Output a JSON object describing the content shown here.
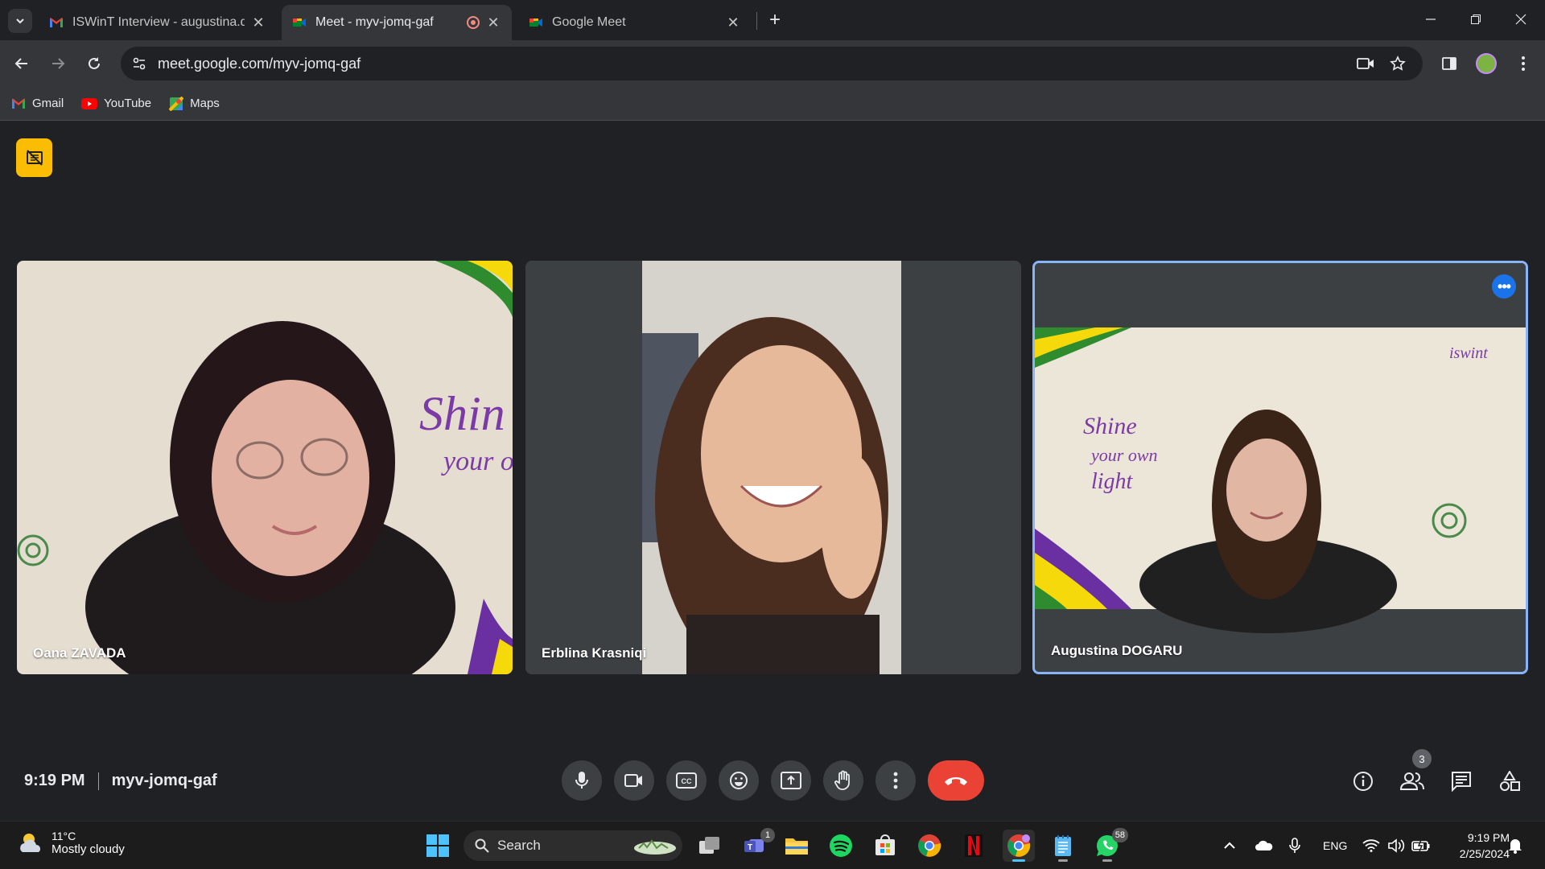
{
  "tabs": [
    {
      "title": "ISWinT Interview - augustina.do",
      "favicon": "gmail-icon"
    },
    {
      "title": "Meet - myv-jomq-gaf",
      "favicon": "meet-icon",
      "recording": true
    },
    {
      "title": "Google Meet",
      "favicon": "meet-icon"
    }
  ],
  "address": {
    "url": "meet.google.com/myv-jomq-gaf"
  },
  "bookmarks": [
    {
      "label": "Gmail",
      "icon": "gmail-icon"
    },
    {
      "label": "YouTube",
      "icon": "youtube-icon"
    },
    {
      "label": "Maps",
      "icon": "maps-icon"
    }
  ],
  "participants": [
    {
      "name": "Oana ZAVADA"
    },
    {
      "name": "Erblina Krasniqi"
    },
    {
      "name": "Augustina DOGARU",
      "speaking": true
    }
  ],
  "meeting": {
    "time": "9:19 PM",
    "code": "myv-jomq-gaf",
    "people_count": "3"
  },
  "taskbar": {
    "temp": "11°C",
    "condition": "Mostly cloudy",
    "search_label": "Search",
    "teams_badge": "1",
    "whatsapp_badge": "58",
    "lang": "ENG",
    "time": "9:19 PM",
    "date": "2/25/2024"
  },
  "colors": {
    "accent": "#8ab4f8",
    "end_call": "#ea4335",
    "recording": "#fbbc04"
  }
}
